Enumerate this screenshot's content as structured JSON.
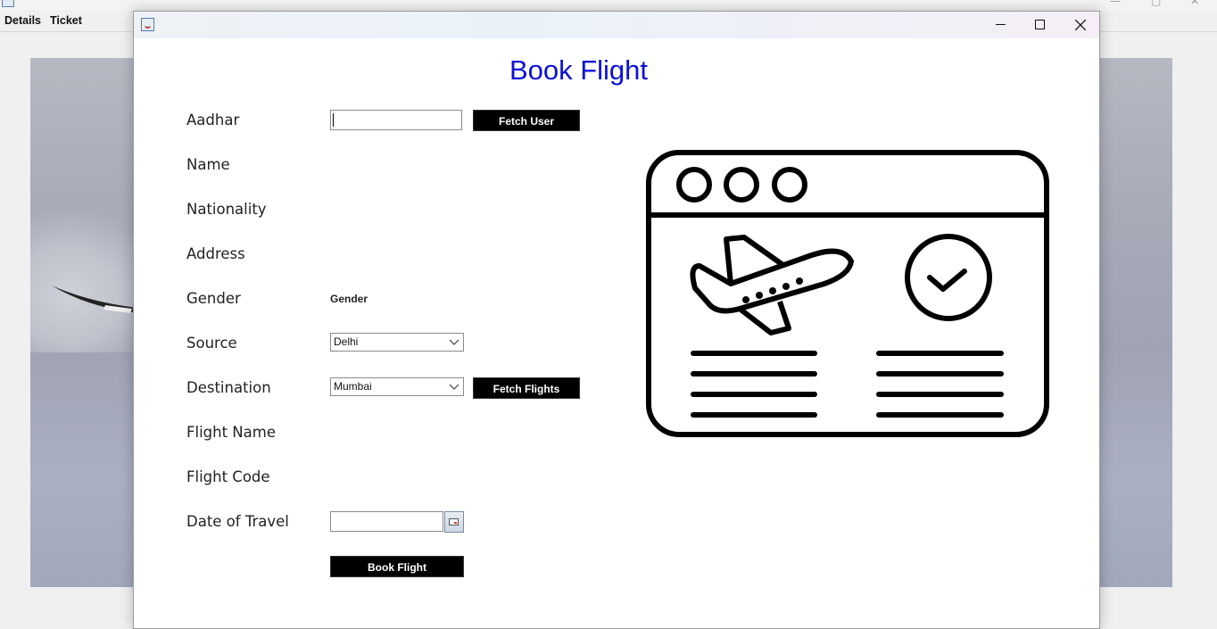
{
  "background_app": {
    "menu": [
      "Details",
      "Ticket"
    ]
  },
  "dialog": {
    "title": "Book Flight",
    "fields": {
      "aadhar_label": "Aadhar",
      "aadhar_value": "",
      "name_label": "Name",
      "nationality_label": "Nationality",
      "address_label": "Address",
      "gender_label": "Gender",
      "gender_value": "Gender",
      "source_label": "Source",
      "source_selected": "Delhi",
      "destination_label": "Destination",
      "destination_selected": "Mumbai",
      "flight_name_label": "Flight Name",
      "flight_code_label": "Flight Code",
      "date_label": "Date of Travel",
      "date_value": ""
    },
    "buttons": {
      "fetch_user": "Fetch User",
      "fetch_flights": "Fetch Flights",
      "book_flight": "Book Flight"
    },
    "illustration_icon": "flight-booking-icon",
    "colors": {
      "title": "#0a10d8",
      "button_bg": "#000000",
      "button_text": "#ffffff"
    }
  }
}
